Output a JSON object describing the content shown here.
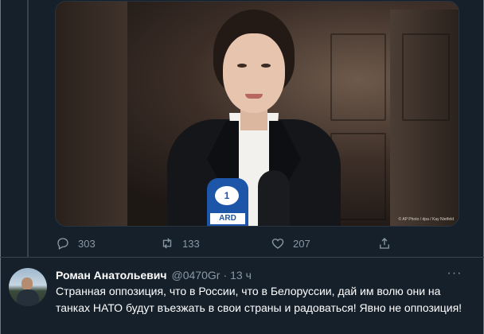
{
  "tweet": {
    "image": {
      "description_icon": "photo",
      "credit": "© AP Photo / dpa / Kay Nietfeld",
      "mic_logo": "1",
      "mic_label": "ARD"
    },
    "actions": {
      "replies": "303",
      "retweets": "133",
      "likes": "207"
    }
  },
  "reply": {
    "name": "Роман Анатольевич",
    "handle": "@0470Gr",
    "separator": "·",
    "time": "13 ч",
    "more": "···",
    "text": "Странная оппозиция, что в России, что в Белоруссии, дай им волю они на танках НАТО будут въезжать в свои страны и радоваться! Явно не оппозиция!"
  },
  "colors": {
    "background": "#15202b",
    "muted": "#8899a6",
    "divider": "#38444d"
  }
}
